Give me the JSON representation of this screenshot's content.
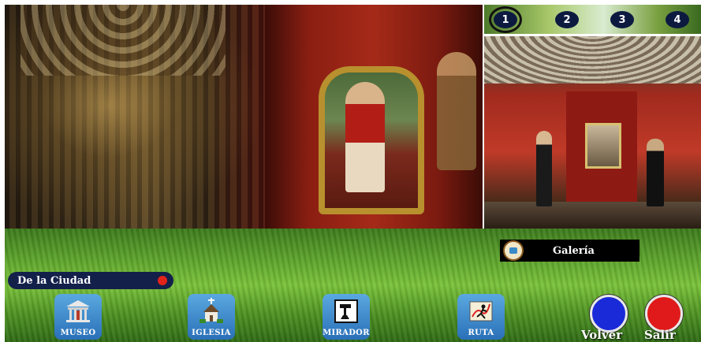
{
  "thumbnails": [
    {
      "label": "1",
      "active": true
    },
    {
      "label": "2",
      "active": false
    },
    {
      "label": "3",
      "active": false
    },
    {
      "label": "4",
      "active": false
    }
  ],
  "gallery": {
    "label": "Galería"
  },
  "city": {
    "label": "De la Ciudad",
    "dot_color": "#e2231a"
  },
  "nav": [
    {
      "label": "MUSEO",
      "icon": "museum-icon"
    },
    {
      "label": "IGLESIA",
      "icon": "church-icon"
    },
    {
      "label": "MIRADOR",
      "icon": "viewpoint-icon"
    },
    {
      "label": "RUTA",
      "icon": "route-icon"
    }
  ],
  "actions": {
    "back": {
      "label": "Volver",
      "color": "#1a2ad8"
    },
    "exit": {
      "label": "Salir",
      "color": "#e01a1a"
    }
  }
}
